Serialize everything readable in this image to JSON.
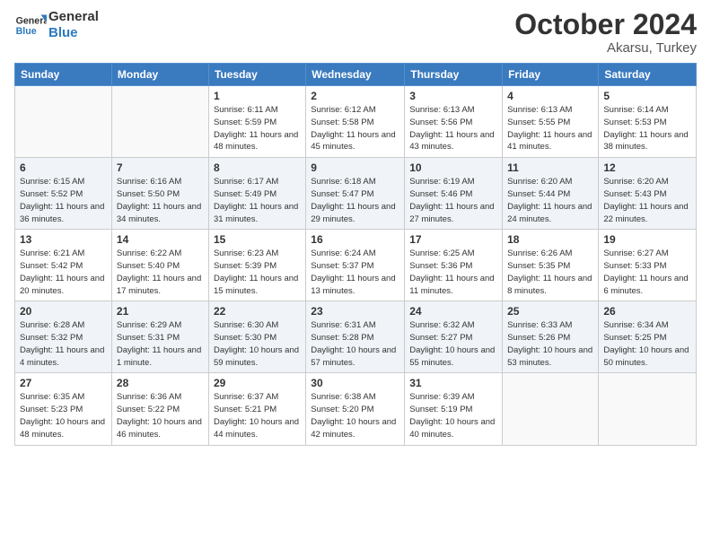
{
  "header": {
    "logo_line1": "General",
    "logo_line2": "Blue",
    "month": "October 2024",
    "location": "Akarsu, Turkey"
  },
  "weekdays": [
    "Sunday",
    "Monday",
    "Tuesday",
    "Wednesday",
    "Thursday",
    "Friday",
    "Saturday"
  ],
  "weeks": [
    [
      {
        "day": "",
        "empty": true
      },
      {
        "day": "",
        "empty": true
      },
      {
        "day": "1",
        "sunrise": "6:11 AM",
        "sunset": "5:59 PM",
        "daylight": "11 hours and 48 minutes."
      },
      {
        "day": "2",
        "sunrise": "6:12 AM",
        "sunset": "5:58 PM",
        "daylight": "11 hours and 45 minutes."
      },
      {
        "day": "3",
        "sunrise": "6:13 AM",
        "sunset": "5:56 PM",
        "daylight": "11 hours and 43 minutes."
      },
      {
        "day": "4",
        "sunrise": "6:13 AM",
        "sunset": "5:55 PM",
        "daylight": "11 hours and 41 minutes."
      },
      {
        "day": "5",
        "sunrise": "6:14 AM",
        "sunset": "5:53 PM",
        "daylight": "11 hours and 38 minutes."
      }
    ],
    [
      {
        "day": "6",
        "sunrise": "6:15 AM",
        "sunset": "5:52 PM",
        "daylight": "11 hours and 36 minutes."
      },
      {
        "day": "7",
        "sunrise": "6:16 AM",
        "sunset": "5:50 PM",
        "daylight": "11 hours and 34 minutes."
      },
      {
        "day": "8",
        "sunrise": "6:17 AM",
        "sunset": "5:49 PM",
        "daylight": "11 hours and 31 minutes."
      },
      {
        "day": "9",
        "sunrise": "6:18 AM",
        "sunset": "5:47 PM",
        "daylight": "11 hours and 29 minutes."
      },
      {
        "day": "10",
        "sunrise": "6:19 AM",
        "sunset": "5:46 PM",
        "daylight": "11 hours and 27 minutes."
      },
      {
        "day": "11",
        "sunrise": "6:20 AM",
        "sunset": "5:44 PM",
        "daylight": "11 hours and 24 minutes."
      },
      {
        "day": "12",
        "sunrise": "6:20 AM",
        "sunset": "5:43 PM",
        "daylight": "11 hours and 22 minutes."
      }
    ],
    [
      {
        "day": "13",
        "sunrise": "6:21 AM",
        "sunset": "5:42 PM",
        "daylight": "11 hours and 20 minutes."
      },
      {
        "day": "14",
        "sunrise": "6:22 AM",
        "sunset": "5:40 PM",
        "daylight": "11 hours and 17 minutes."
      },
      {
        "day": "15",
        "sunrise": "6:23 AM",
        "sunset": "5:39 PM",
        "daylight": "11 hours and 15 minutes."
      },
      {
        "day": "16",
        "sunrise": "6:24 AM",
        "sunset": "5:37 PM",
        "daylight": "11 hours and 13 minutes."
      },
      {
        "day": "17",
        "sunrise": "6:25 AM",
        "sunset": "5:36 PM",
        "daylight": "11 hours and 11 minutes."
      },
      {
        "day": "18",
        "sunrise": "6:26 AM",
        "sunset": "5:35 PM",
        "daylight": "11 hours and 8 minutes."
      },
      {
        "day": "19",
        "sunrise": "6:27 AM",
        "sunset": "5:33 PM",
        "daylight": "11 hours and 6 minutes."
      }
    ],
    [
      {
        "day": "20",
        "sunrise": "6:28 AM",
        "sunset": "5:32 PM",
        "daylight": "11 hours and 4 minutes."
      },
      {
        "day": "21",
        "sunrise": "6:29 AM",
        "sunset": "5:31 PM",
        "daylight": "11 hours and 1 minute."
      },
      {
        "day": "22",
        "sunrise": "6:30 AM",
        "sunset": "5:30 PM",
        "daylight": "10 hours and 59 minutes."
      },
      {
        "day": "23",
        "sunrise": "6:31 AM",
        "sunset": "5:28 PM",
        "daylight": "10 hours and 57 minutes."
      },
      {
        "day": "24",
        "sunrise": "6:32 AM",
        "sunset": "5:27 PM",
        "daylight": "10 hours and 55 minutes."
      },
      {
        "day": "25",
        "sunrise": "6:33 AM",
        "sunset": "5:26 PM",
        "daylight": "10 hours and 53 minutes."
      },
      {
        "day": "26",
        "sunrise": "6:34 AM",
        "sunset": "5:25 PM",
        "daylight": "10 hours and 50 minutes."
      }
    ],
    [
      {
        "day": "27",
        "sunrise": "6:35 AM",
        "sunset": "5:23 PM",
        "daylight": "10 hours and 48 minutes."
      },
      {
        "day": "28",
        "sunrise": "6:36 AM",
        "sunset": "5:22 PM",
        "daylight": "10 hours and 46 minutes."
      },
      {
        "day": "29",
        "sunrise": "6:37 AM",
        "sunset": "5:21 PM",
        "daylight": "10 hours and 44 minutes."
      },
      {
        "day": "30",
        "sunrise": "6:38 AM",
        "sunset": "5:20 PM",
        "daylight": "10 hours and 42 minutes."
      },
      {
        "day": "31",
        "sunrise": "6:39 AM",
        "sunset": "5:19 PM",
        "daylight": "10 hours and 40 minutes."
      },
      {
        "day": "",
        "empty": true
      },
      {
        "day": "",
        "empty": true
      }
    ]
  ],
  "labels": {
    "sunrise": "Sunrise:",
    "sunset": "Sunset:",
    "daylight": "Daylight:"
  }
}
